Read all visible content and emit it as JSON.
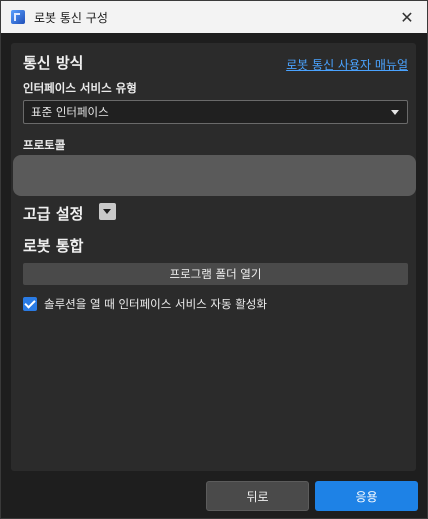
{
  "window": {
    "title": "로봇 통신 구성",
    "close_symbol": "✕"
  },
  "communication": {
    "section_title": "통신 방식",
    "help_link": "로봇 통신 사용자 매뉴얼",
    "service_type_label": "인터페이스 서비스 유형",
    "service_type_value": "표준 인터페이스",
    "protocol_label": "프로토콜"
  },
  "advanced": {
    "title": "고급 설정"
  },
  "integration": {
    "title": "로봇 통합",
    "open_folder_button": "프로그램 폴더 열기",
    "auto_activate_label": "솔루션을 열 때 인터페이스 서비스 자동 활성화",
    "auto_activate_checked": true
  },
  "footer": {
    "back_button": "뒤로",
    "apply_button": "응용"
  },
  "colors": {
    "accent": "#1e82e6",
    "link": "#4aa3ff"
  }
}
